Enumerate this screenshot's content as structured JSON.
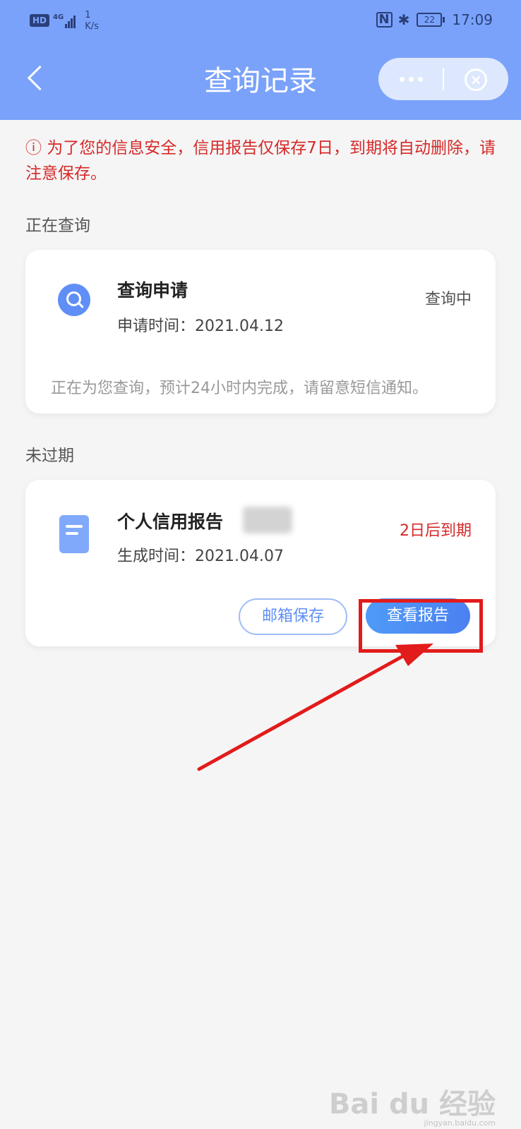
{
  "status_bar": {
    "hd": "HD",
    "network": "4G",
    "speed_value": "1",
    "speed_unit": "K/s",
    "nfc": "N",
    "battery": "22",
    "time": "17:09"
  },
  "nav": {
    "title": "查询记录"
  },
  "notice": "ⓘ 为了您的信息安全，信用报告仅保存7日，到期将自动删除，请注意保存。",
  "in_progress": {
    "section_label": "正在查询",
    "card": {
      "title": "查询申请",
      "subtitle": "申请时间：2021.04.12",
      "status": "查询中",
      "footer": "正在为您查询，预计24小时内完成，请留意短信通知。"
    }
  },
  "unexpired": {
    "section_label": "未过期",
    "card": {
      "title": "个人信用报告",
      "subtitle": "生成时间：2021.04.07",
      "expire": "2日后到期",
      "email_button": "邮箱保存",
      "view_button": "查看报告"
    }
  },
  "watermark": {
    "brand": "Bai du 经验",
    "url": "jingyan.baidu.com"
  },
  "colors": {
    "header": "#7aa2fa",
    "accent": "#4c80f1",
    "warning": "#d62929",
    "annotation": "#e21b1b"
  }
}
